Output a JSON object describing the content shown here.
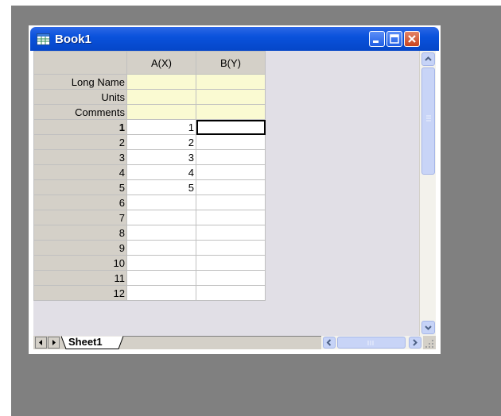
{
  "window": {
    "title": "Book1"
  },
  "grid": {
    "columns": [
      "A(X)",
      "B(Y)"
    ],
    "meta_rows": [
      "Long Name",
      "Units",
      "Comments"
    ],
    "rows": [
      {
        "n": "1",
        "a": "1",
        "b": ""
      },
      {
        "n": "2",
        "a": "2",
        "b": ""
      },
      {
        "n": "3",
        "a": "3",
        "b": ""
      },
      {
        "n": "4",
        "a": "4",
        "b": ""
      },
      {
        "n": "5",
        "a": "5",
        "b": ""
      },
      {
        "n": "6",
        "a": "",
        "b": ""
      },
      {
        "n": "7",
        "a": "",
        "b": ""
      },
      {
        "n": "8",
        "a": "",
        "b": ""
      },
      {
        "n": "9",
        "a": "",
        "b": ""
      },
      {
        "n": "10",
        "a": "",
        "b": ""
      },
      {
        "n": "11",
        "a": "",
        "b": ""
      },
      {
        "n": "12",
        "a": "",
        "b": ""
      }
    ],
    "active_cell": "row 1, column B(Y)"
  },
  "sheet_tab": {
    "label": "Sheet1"
  },
  "colors": {
    "title_bar": "#0a52dc",
    "mdi_background": "#808080",
    "meta_rows_fill": "#fafad2",
    "header_fill": "#d4d0c8"
  },
  "icons": [
    "worksheet-icon",
    "minimize-icon",
    "maximize-icon",
    "close-icon",
    "scroll-up-icon",
    "scroll-down-icon",
    "scroll-left-icon",
    "scroll-right-icon",
    "size-grip-icon"
  ]
}
